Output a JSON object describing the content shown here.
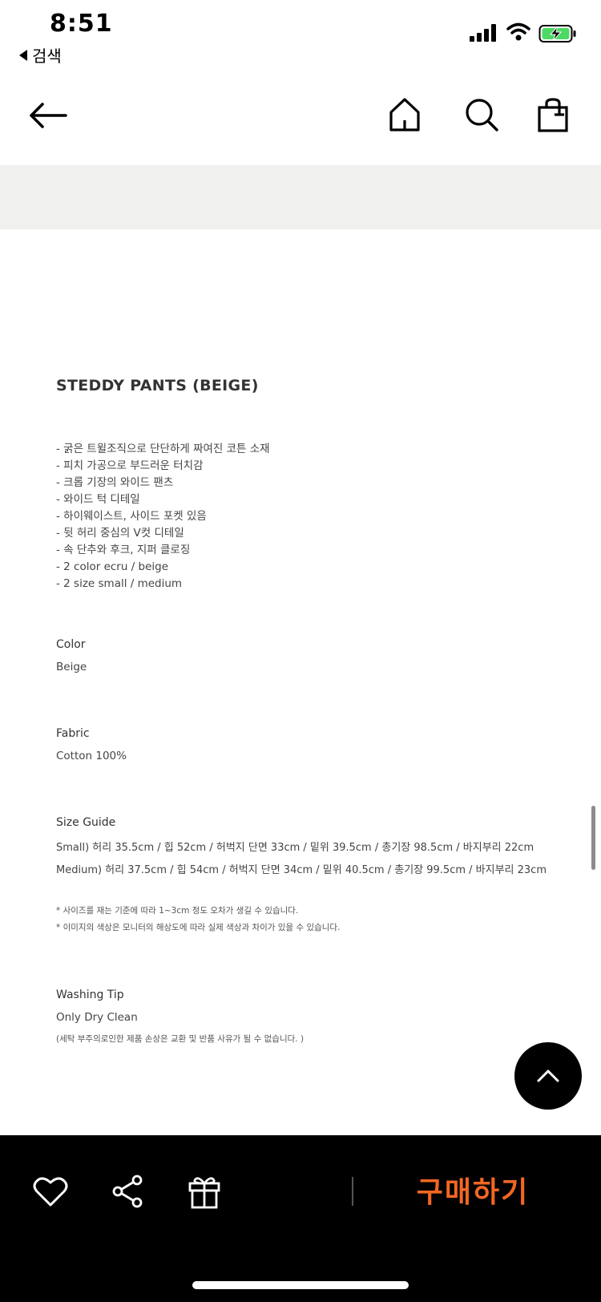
{
  "status_bar": {
    "time": "8:51",
    "back_label": "검색"
  },
  "nav": {
    "icons": [
      "back-arrow-icon",
      "home-icon",
      "search-icon",
      "shopping-bag-icon"
    ]
  },
  "product": {
    "title": "STEDDY PANTS (BEIGE)",
    "features": [
      "- 굵은 트윌조직으로 단단하게 짜여진 코튼 소재",
      "- 피치 가공으로 부드러운 터치감",
      "- 크롭 기장의 와이드 팬츠",
      "- 와이드 턱 디테일",
      "- 하이웨이스트, 사이드 포켓 있음",
      "- 뒷 허리 중심의 V컷 디테일",
      "- 속 단추와 후크, 지퍼 클로징",
      "- 2 color  ecru / beige",
      "- 2 size  small / medium"
    ],
    "color_label": "Color",
    "color_value": "Beige",
    "fabric_label": "Fabric",
    "fabric_value": "Cotton 100%",
    "size_label": "Size Guide",
    "size_small": "Small) 허리 35.5cm / 힙 52cm / 허벅지 단면 33cm / 밑위 39.5cm / 총기장 98.5cm / 바지부리 22cm",
    "size_medium": "Medium) 허리 37.5cm / 힙 54cm / 허벅지 단면 34cm / 밑위 40.5cm / 총기장 99.5cm / 바지부리 23cm",
    "size_note_1": "* 사이즈를 재는 기준에 따라 1~3cm 정도 오차가 생길 수 있습니다.",
    "size_note_2": "* 이미지의 색상은 모니터의 해상도에 따라 실제 색상과 차이가 있을 수 있습니다.",
    "washing_label": "Washing Tip",
    "washing_value": "Only Dry Clean",
    "washing_note": "(세탁 부주의로인한 제품 손상은 교환 및 반품 사유가 될 수 없습니다. )"
  },
  "bottom_bar": {
    "icons": [
      "heart-icon",
      "share-icon",
      "gift-icon"
    ],
    "buy_label": "구매하기",
    "buy_color": "#f26722"
  }
}
